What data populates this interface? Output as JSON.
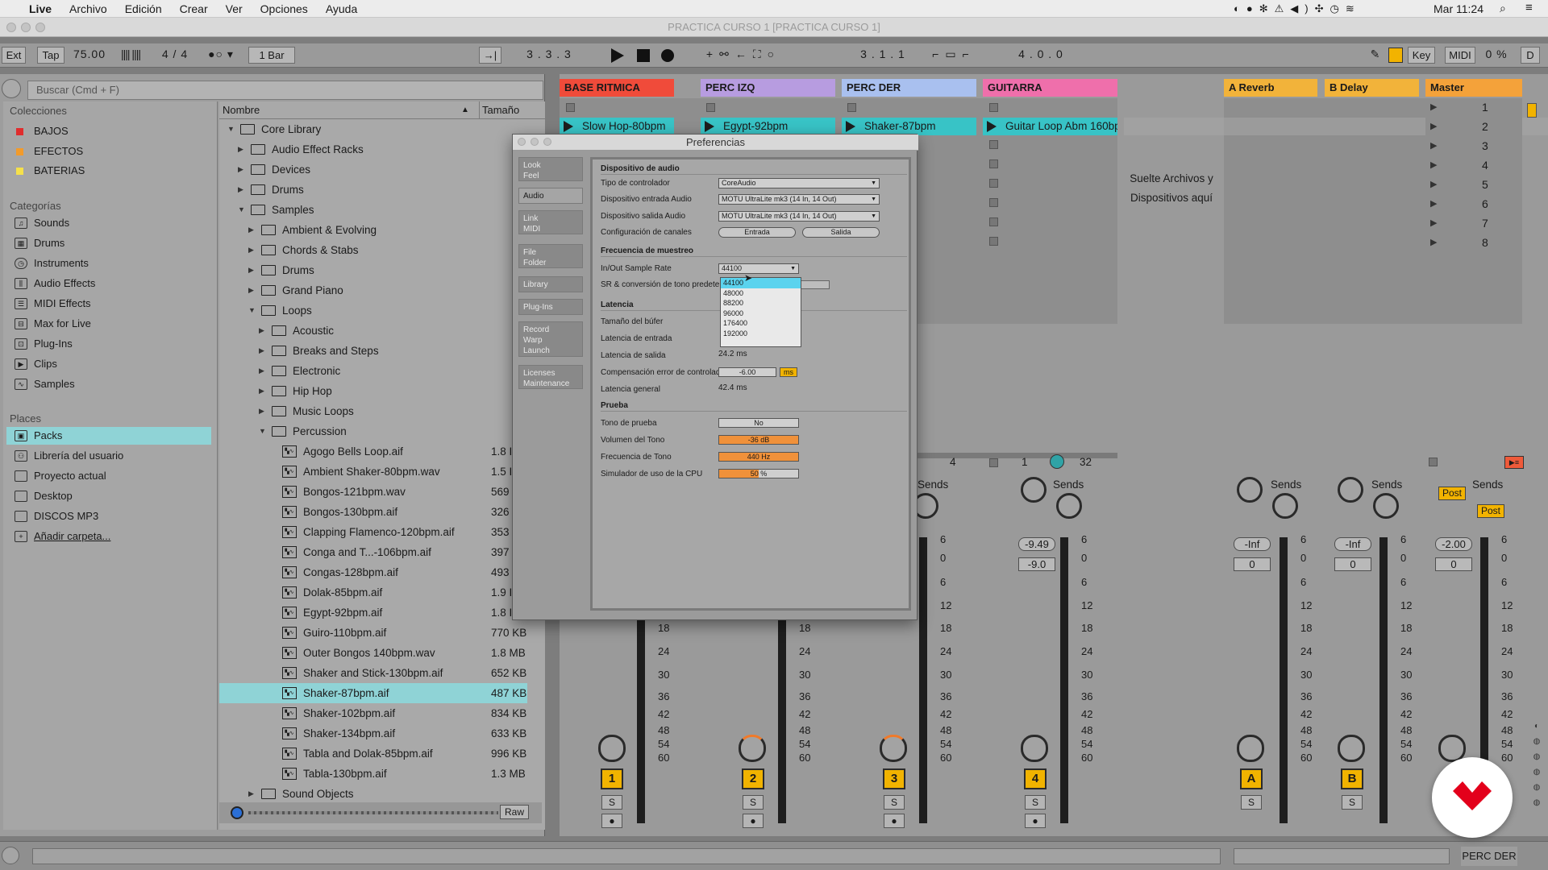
{
  "menubar": {
    "apple": "",
    "app": "Live",
    "items": [
      "Archivo",
      "Edición",
      "Crear",
      "Ver",
      "Opciones",
      "Ayuda"
    ],
    "clock": "Mar 11:24"
  },
  "window_title": "PRACTICA CURSO 1  [PRACTICA CURSO 1]",
  "transport": {
    "ext": "Ext",
    "tap": "Tap",
    "tempo": "75.00",
    "sig": "4 / 4",
    "quant": "1 Bar",
    "pos1": "3 .   3 .   3",
    "pos2": "3 .   1 .   1",
    "pos3": "4 .   0 .   0",
    "key": "Key",
    "midi": "MIDI",
    "cpu": "0 %",
    "d": "D"
  },
  "browser": {
    "search_placeholder": "Buscar (Cmd + F)",
    "collections_header": "Colecciones",
    "collections": [
      {
        "label": "BAJOS",
        "color": "#e02d2d"
      },
      {
        "label": "EFECTOS",
        "color": "#f29b2b"
      },
      {
        "label": "BATERIAS",
        "color": "#f5e04a"
      }
    ],
    "categories_header": "Categorías",
    "categories": [
      "Sounds",
      "Drums",
      "Instruments",
      "Audio Effects",
      "MIDI Effects",
      "Max for Live",
      "Plug-Ins",
      "Clips",
      "Samples"
    ],
    "places_header": "Places",
    "places": [
      "Packs",
      "Librería del usuario",
      "Proyecto actual",
      "Desktop",
      "DISCOS MP3",
      "Añadir carpeta..."
    ],
    "col_name": "Nombre",
    "col_size": "Tamaño",
    "tree": [
      {
        "label": "Core Library",
        "indent": 0,
        "type": "lib",
        "open": true,
        "size": ""
      },
      {
        "label": "Audio Effect Racks",
        "indent": 1,
        "type": "folder",
        "open": false,
        "size": ""
      },
      {
        "label": "Devices",
        "indent": 1,
        "type": "folder",
        "open": false,
        "size": ""
      },
      {
        "label": "Drums",
        "indent": 1,
        "type": "folder",
        "open": false,
        "size": ""
      },
      {
        "label": "Samples",
        "indent": 1,
        "type": "folder",
        "open": true,
        "size": ""
      },
      {
        "label": "Ambient & Evolving",
        "indent": 2,
        "type": "folder",
        "open": false,
        "size": ""
      },
      {
        "label": "Chords & Stabs",
        "indent": 2,
        "type": "folder",
        "open": false,
        "size": ""
      },
      {
        "label": "Drums",
        "indent": 2,
        "type": "folder",
        "open": false,
        "size": ""
      },
      {
        "label": "Grand Piano",
        "indent": 2,
        "type": "folder",
        "open": false,
        "size": ""
      },
      {
        "label": "Loops",
        "indent": 2,
        "type": "folder",
        "open": true,
        "size": ""
      },
      {
        "label": "Acoustic",
        "indent": 3,
        "type": "folder",
        "open": false,
        "size": ""
      },
      {
        "label": "Breaks and Steps",
        "indent": 3,
        "type": "folder",
        "open": false,
        "size": ""
      },
      {
        "label": "Electronic",
        "indent": 3,
        "type": "folder",
        "open": false,
        "size": ""
      },
      {
        "label": "Hip Hop",
        "indent": 3,
        "type": "folder",
        "open": false,
        "size": ""
      },
      {
        "label": "Music Loops",
        "indent": 3,
        "type": "folder",
        "open": false,
        "size": ""
      },
      {
        "label": "Percussion",
        "indent": 3,
        "type": "folder",
        "open": true,
        "size": ""
      },
      {
        "label": "Agogo Bells Loop.aif",
        "indent": 4,
        "type": "file",
        "size": "1.8 I"
      },
      {
        "label": "Ambient Shaker-80bpm.wav",
        "indent": 4,
        "type": "file",
        "size": "1.5 I"
      },
      {
        "label": "Bongos-121bpm.wav",
        "indent": 4,
        "type": "file",
        "size": "569"
      },
      {
        "label": "Bongos-130bpm.aif",
        "indent": 4,
        "type": "file",
        "size": "326"
      },
      {
        "label": "Clapping Flamenco-120bpm.aif",
        "indent": 4,
        "type": "file",
        "size": "353"
      },
      {
        "label": "Conga and T...-106bpm.aif",
        "indent": 4,
        "type": "file",
        "size": "397"
      },
      {
        "label": "Congas-128bpm.aif",
        "indent": 4,
        "type": "file",
        "size": "493"
      },
      {
        "label": "Dolak-85bpm.aif",
        "indent": 4,
        "type": "file",
        "size": "1.9 I"
      },
      {
        "label": "Egypt-92bpm.aif",
        "indent": 4,
        "type": "file",
        "size": "1.8 I"
      },
      {
        "label": "Guiro-110bpm.aif",
        "indent": 4,
        "type": "file",
        "size": "770 KB"
      },
      {
        "label": "Outer Bongos 140bpm.wav",
        "indent": 4,
        "type": "file",
        "size": "1.8 MB"
      },
      {
        "label": "Shaker and Stick-130bpm.aif",
        "indent": 4,
        "type": "file",
        "size": "652 KB"
      },
      {
        "label": "Shaker-87bpm.aif",
        "indent": 4,
        "type": "file",
        "size": "487 KB",
        "selected": true
      },
      {
        "label": "Shaker-102bpm.aif",
        "indent": 4,
        "type": "file",
        "size": "834 KB"
      },
      {
        "label": "Shaker-134bpm.aif",
        "indent": 4,
        "type": "file",
        "size": "633 KB"
      },
      {
        "label": "Tabla and Dolak-85bpm.aif",
        "indent": 4,
        "type": "file",
        "size": "996 KB"
      },
      {
        "label": "Tabla-130bpm.aif",
        "indent": 4,
        "type": "file",
        "size": "1.3 MB"
      },
      {
        "label": "Sound Objects",
        "indent": 2,
        "type": "folder",
        "open": false,
        "size": ""
      }
    ],
    "raw": "Raw"
  },
  "session": {
    "tracks": [
      {
        "name": "BASE RITMICA",
        "color": "#f04b3a",
        "clip": "Slow Hop-80bpm",
        "clipcolor": "#38c3c6",
        "num": "1"
      },
      {
        "name": "PERC IZQ",
        "color": "#b79ce0",
        "clip": "Egypt-92bpm",
        "clipcolor": "#38c3c6",
        "num": "2"
      },
      {
        "name": "PERC DER",
        "color": "#a9c0ef",
        "clip": "Shaker-87bpm",
        "clipcolor": "#38c3c6",
        "num": "3"
      },
      {
        "name": "GUITARRA",
        "color": "#ef6fab",
        "clip": "Guitar Loop Abm 160bp",
        "clipcolor": "#38c3c6",
        "num": "4"
      }
    ],
    "drop_text": "Suelte Archivos y Dispositivos aquí",
    "returns": [
      {
        "name": "A Reverb",
        "color": "#f2b33a",
        "num": "A"
      },
      {
        "name": "B Delay",
        "color": "#f2b33a",
        "num": "B"
      }
    ],
    "master": {
      "name": "Master",
      "color": "#f4a23a"
    },
    "scenes": [
      "1",
      "2",
      "3",
      "4",
      "5",
      "6",
      "7",
      "8"
    ],
    "sends": "Sends",
    "post": "Post",
    "solo": "S",
    "io_g_vals": [
      "4",
      "1",
      "32"
    ],
    "vols": {
      "guitar": "-9.49",
      "guitar_pan": "-9.0",
      "a": "-Inf",
      "a2": "0",
      "b": "-Inf",
      "b2": "0",
      "master": "-2.00",
      "master2": "0"
    },
    "db_ticks": [
      "6",
      "0",
      "6",
      "12",
      "18",
      "24",
      "30",
      "36",
      "42",
      "48",
      "54",
      "60"
    ],
    "bottom_track": "PERC DER"
  },
  "prefs": {
    "title": "Preferencias",
    "tabs": [
      "Look\nFeel",
      "Audio",
      "Link\nMIDI",
      "File\nFolder",
      "Library",
      "Plug-Ins",
      "Record\nWarp\nLaunch",
      "Licenses\nMaintenance"
    ],
    "sec_device": "Dispositivo de audio",
    "driver_label": "Tipo de controlador",
    "driver_val": "CoreAudio",
    "in_label": "Dispositivo entrada Audio",
    "in_val": "MOTU UltraLite mk3 (14 In, 14 Out)",
    "out_label": "Dispositivo salida Audio",
    "out_val": "MOTU UltraLite mk3 (14 In, 14 Out)",
    "chan_label": "Configuración de canales",
    "chan_in": "Entrada",
    "chan_out": "Salida",
    "sec_rate": "Frecuencia de muestreo",
    "rate_label": "In/Out Sample Rate",
    "rate_val": "44100",
    "src_label": "SR & conversión de tono predeterm",
    "rates": [
      "44100",
      "48000",
      "88200",
      "96000",
      "176400",
      "192000"
    ],
    "sec_lat": "Latencia",
    "buf_label": "Tamaño del búfer",
    "inlat_label": "Latencia de entrada",
    "outlat_label": "Latencia de salida",
    "outlat_val": "24.2 ms",
    "comp_label": "Compensación error de controlador",
    "comp_val": "-6.00",
    "comp_unit": "ms",
    "total_label": "Latencia general",
    "total_val": "42.4 ms",
    "sec_test": "Prueba",
    "tone_label": "Tono de prueba",
    "tone_val": "No",
    "vol_label": "Volumen del Tono",
    "vol_val": "-36 dB",
    "freq_label": "Frecuencia de Tono",
    "freq_val": "440 Hz",
    "cpu_label": "Simulador de uso de la CPU",
    "cpu_val": "50 %"
  }
}
